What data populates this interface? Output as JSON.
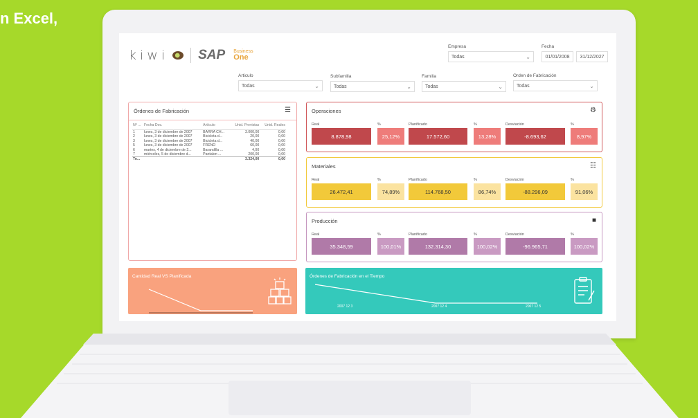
{
  "headline": "n Excel,",
  "header": {
    "logo_kiwi": "kiwi",
    "logo_sap": "SAP",
    "logo_business": "Business",
    "logo_one": "One"
  },
  "filters": {
    "empresa": {
      "label": "Empresa",
      "value": "Todas"
    },
    "fecha": {
      "label": "Fecha",
      "from": "01/01/2008",
      "to": "31/12/2027"
    },
    "articulo": {
      "label": "Articulo",
      "value": "Todas"
    },
    "subfamilia": {
      "label": "Subfamilia",
      "value": "Todas"
    },
    "familia": {
      "label": "Familia",
      "value": "Todas"
    },
    "orden": {
      "label": "Orden de Fabricación",
      "value": "Todas"
    }
  },
  "ordenes": {
    "title": "Órdenes de Fabricación",
    "columns": [
      "Nº ...",
      "Fecha Doc.",
      "Artículo",
      "Unid. Previstas",
      "Unid. Reales"
    ],
    "rows": [
      [
        "1",
        "lunes, 3 de diciembre de 2007",
        "BARRA CH...",
        "3.000,00",
        "0,00"
      ],
      [
        "2",
        "lunes, 3 de diciembre de 2007",
        "Bicicleta d...",
        "20,00",
        "0,00"
      ],
      [
        "3",
        "lunes, 3 de diciembre de 2007",
        "Bicicleta d...",
        "40,00",
        "0,00"
      ],
      [
        "5",
        "lunes, 3 de diciembre de 2007",
        "FRENO",
        "60,00",
        "0,00"
      ],
      [
        "6",
        "martes, 4 de diciembre de 2...",
        "Barandilla ...",
        "4,00",
        "0,00"
      ],
      [
        "7",
        "miércoles, 5 de diciembre d...",
        "Pantalon ...",
        "200,00",
        "0,00"
      ]
    ],
    "total": [
      "To...",
      "",
      "",
      "3.324,00",
      "0,00"
    ]
  },
  "operaciones": {
    "title": "Operaciones",
    "real_label": "Real",
    "real": "8.878,98",
    "pct1_label": "%",
    "pct1": "25,12%",
    "plan_label": "Planificado",
    "plan": "17.572,60",
    "pct2_label": "%",
    "pct2": "13,28%",
    "desv_label": "Desviación",
    "desv": "-8.693,62",
    "pct3_label": "%",
    "pct3": "8,97%",
    "color": "#c0484c",
    "color_light": "#ee7c7a"
  },
  "materiales": {
    "title": "Materiales",
    "real_label": "Real",
    "real": "26.472,41",
    "pct1_label": "%",
    "pct1": "74,89%",
    "plan_label": "Planificado",
    "plan": "114.768,50",
    "pct2_label": "%",
    "pct2": "86,74%",
    "desv_label": "Desviación",
    "desv": "-88.296,09",
    "pct3_label": "%",
    "pct3": "91,06%",
    "color": "#f2c93a",
    "color_light": "#fbe3a0"
  },
  "produccion": {
    "title": "Producción",
    "real_label": "Real",
    "real": "35.348,59",
    "pct1_label": "%",
    "pct1": "100,01%",
    "plan_label": "Planificado",
    "plan": "132.314,30",
    "pct2_label": "%",
    "pct2": "100,02%",
    "desv_label": "Desviación",
    "desv": "-96.965,71",
    "pct3_label": "%",
    "pct3": "100,02%",
    "color": "#b07aa8",
    "color_light": "#c99ac2"
  },
  "card_cantidad": {
    "title": "Cantidad Real VS Planificada",
    "color": "#f9a27e"
  },
  "card_tiempo": {
    "title": "Órdenes de Fabricación en el Tiempo",
    "ticks": [
      "2007 12 3",
      "2007 12 4",
      "2007 12 5"
    ],
    "color": "#34c9bb"
  }
}
